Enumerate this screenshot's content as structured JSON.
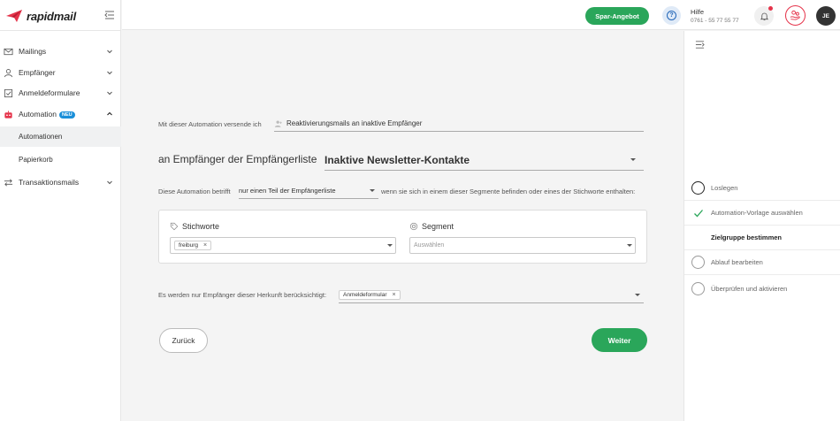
{
  "brand": {
    "name": "rapidmail",
    "accent": "#e5334a",
    "green": "#2aa65a",
    "blue": "#1a8fd9"
  },
  "sidebar": {
    "items": [
      {
        "label": "Mailings",
        "icon": "envelope-icon"
      },
      {
        "label": "Empfänger",
        "icon": "user-icon"
      },
      {
        "label": "Anmeldeformulare",
        "icon": "form-check-icon"
      },
      {
        "label": "Automation",
        "icon": "robot-icon",
        "badge": "NEU"
      },
      {
        "label": "Transaktionsmails",
        "icon": "swap-arrows-icon"
      }
    ],
    "subitems": [
      {
        "label": "Automationen",
        "active": true
      },
      {
        "label": "Papierkorb",
        "active": false
      }
    ]
  },
  "topbar": {
    "promo_label": "Spar-Angebot",
    "help_title": "Hilfe",
    "help_phone": "0761 - 55 77 55 77",
    "avatar_initials": "JE"
  },
  "main": {
    "send_label": "Mit dieser Automation versende ich",
    "send_value": "Reaktivierungsmails an inaktive Empfänger",
    "list_label": "an Empfänger der Empfängerliste",
    "list_value": "Inaktive Newsletter-Kontakte",
    "scope_label": "Diese Automation betrifft",
    "scope_value": "nur einen Teil der Empfängerliste",
    "scope_suffix": "wenn sie sich in einem dieser Segmente befinden oder eines der Stichworte enthalten:",
    "keywords_title": "Stichworte",
    "keywords_chip": "freiburg",
    "segment_title": "Segment",
    "segment_placeholder": "Auswählen",
    "origin_label": "Es werden nur Empfänger dieser Herkunft berücksichtigt:",
    "origin_chip": "Anmeldeformular",
    "back_label": "Zurück",
    "next_label": "Weiter"
  },
  "steps": [
    {
      "label": "Loslegen",
      "state": "todo-dark"
    },
    {
      "label": "Automation-Vorlage auswählen",
      "state": "done"
    },
    {
      "label": "Zielgruppe bestimmen",
      "state": "current"
    },
    {
      "label": "Ablauf bearbeiten",
      "state": "todo"
    },
    {
      "label": "Überprüfen und aktivieren",
      "state": "todo"
    }
  ]
}
